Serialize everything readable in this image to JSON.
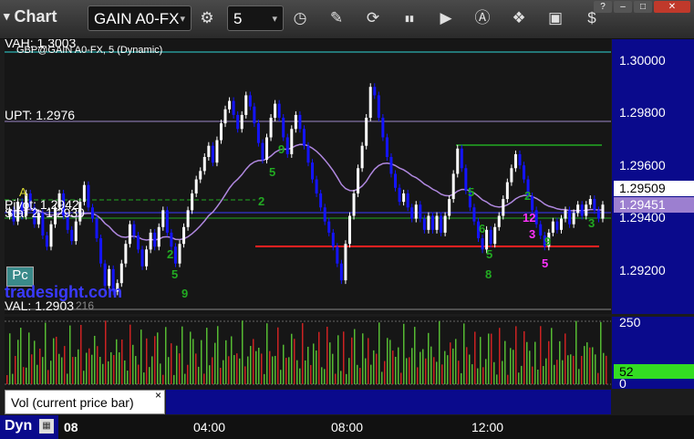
{
  "toolbar": {
    "title": "Chart",
    "symbol": "GAIN A0-FX",
    "interval": "5",
    "window_buttons": [
      "?",
      "–",
      "□",
      "✕"
    ]
  },
  "chart": {
    "series_label": "GBP@GAIN A0-FX, 5 (Dynamic)",
    "lines": {
      "vah": "VAH: 1.3003",
      "upt": "UPT: 1.2976",
      "pivot": "Pivot: 1.2942",
      "star": "Star 2: 1.2939",
      "val": "VAL: 1.2903"
    },
    "pc_label": "Pc",
    "watermark": "tradesight.com",
    "small_markers": [
      "A",
      "216"
    ],
    "price_ticks": [
      "1.30000",
      "1.29800",
      "1.29600",
      "1.29400",
      "1.29200"
    ],
    "last_price": "1.29509",
    "ma_price": "1.29451",
    "colors": {
      "up": "#ffffff",
      "down": "#1414ff",
      "ma": "#b088e0",
      "red": "#ff2020",
      "green": "#22aa22",
      "axis_bg": "#0a0a8c"
    }
  },
  "volume": {
    "title": "Vol (current price bar)",
    "ticks": [
      "250",
      "0"
    ],
    "current": "52",
    "close_glyph": "×"
  },
  "time_axis": {
    "prefix": "Dyn",
    "labels": [
      "08",
      "04:00",
      "08:00",
      "12:00"
    ]
  },
  "chart_data": {
    "type": "candlestick",
    "ylim": [
      1.2912,
      1.301
    ],
    "close_series": [
      1.2949,
      1.2945,
      1.2952,
      1.2947,
      1.2955,
      1.295,
      1.2944,
      1.2948,
      1.294,
      1.2936,
      1.2944,
      1.295,
      1.2955,
      1.2947,
      1.2942,
      1.2938,
      1.2945,
      1.2952,
      1.2958,
      1.295,
      1.2946,
      1.2939,
      1.293,
      1.2922,
      1.2928,
      1.292,
      1.2923,
      1.293,
      1.2937,
      1.2944,
      1.294,
      1.2935,
      1.2929,
      1.2935,
      1.2941,
      1.2936,
      1.2943,
      1.2949,
      1.2941,
      1.2936,
      1.293,
      1.2937,
      1.2943,
      1.2949,
      1.2955,
      1.296,
      1.2963,
      1.2968,
      1.2972,
      1.2966,
      1.2974,
      1.298,
      1.2985,
      1.2988,
      1.2983,
      1.2978,
      1.2983,
      1.299,
      1.2986,
      1.298,
      1.2973,
      1.2967,
      1.2975,
      1.2982,
      1.2987,
      1.2982,
      1.2975,
      1.2969,
      1.2978,
      1.2983,
      1.2978,
      1.2972,
      1.2966,
      1.296,
      1.2955,
      1.295,
      1.2945,
      1.2941,
      1.2936,
      1.293,
      1.2924,
      1.2937,
      1.2947,
      1.2955,
      1.2964,
      1.2972,
      1.2982,
      1.2993,
      1.299,
      1.2982,
      1.2975,
      1.2968,
      1.2962,
      1.2957,
      1.2952,
      1.2955,
      1.295,
      1.2946,
      1.2951,
      1.2946,
      1.2942,
      1.2947,
      1.2942,
      1.2947,
      1.2941,
      1.2947,
      1.2953,
      1.2962,
      1.2971,
      1.2964,
      1.2956,
      1.295,
      1.2945,
      1.2939,
      1.2935,
      1.2942,
      1.2937,
      1.2943,
      1.2947,
      1.2953,
      1.2959,
      1.2964,
      1.2969,
      1.2965,
      1.296,
      1.2954,
      1.2949,
      1.2944,
      1.294,
      1.2936,
      1.2941,
      1.2945,
      1.2942,
      1.2946,
      1.2949,
      1.2944,
      1.2948,
      1.2951,
      1.2947,
      1.2951,
      1.2953,
      1.2949,
      1.2946,
      1.2951
    ]
  }
}
